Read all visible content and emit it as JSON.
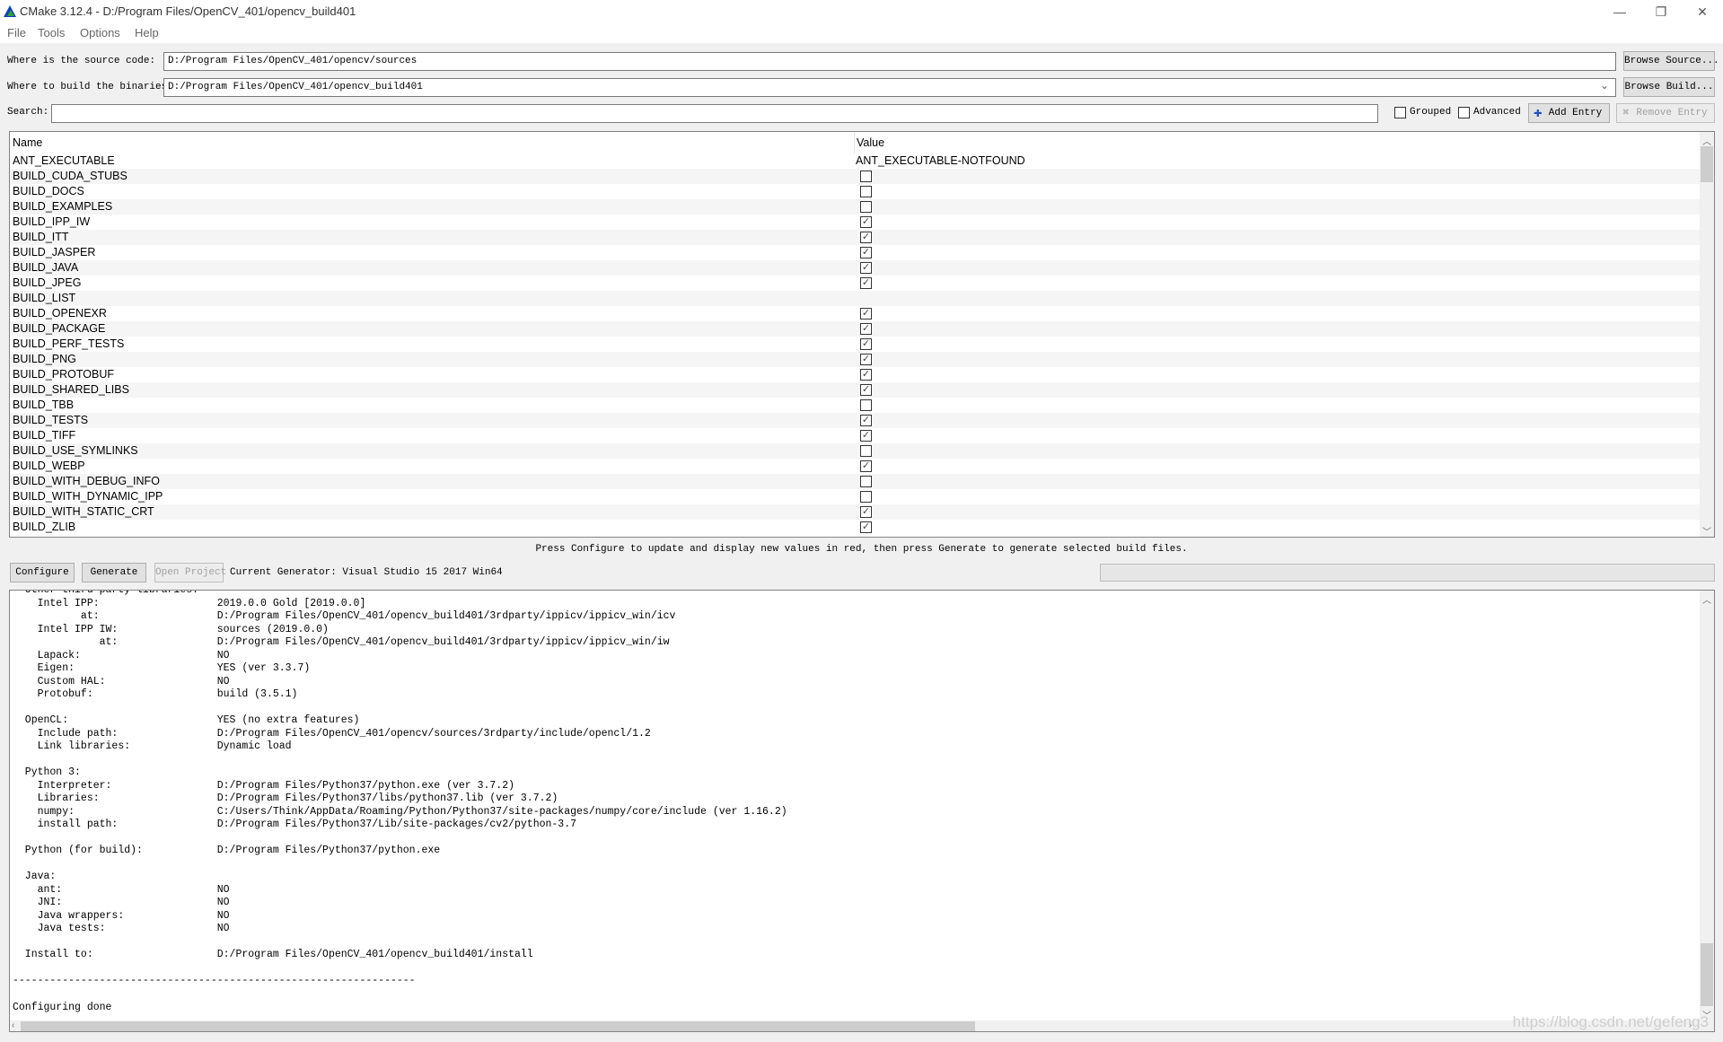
{
  "window": {
    "title": "CMake 3.12.4 - D:/Program Files/OpenCV_401/opencv_build401",
    "minimize": "—",
    "maximize": "❐",
    "close": "✕"
  },
  "menu": [
    "File",
    "Tools",
    "Options",
    "Help"
  ],
  "source": {
    "label": "Where is the source code:",
    "value": "D:/Program Files/OpenCV_401/opencv/sources",
    "button": "Browse Source..."
  },
  "build": {
    "label": "Where to build the binaries:",
    "value": "D:/Program Files/OpenCV_401/opencv_build401",
    "button": "Browse Build...",
    "dropdown_icon": "⌄"
  },
  "search": {
    "label": "Search:",
    "value": "",
    "grouped": {
      "label": "Grouped",
      "checked": false
    },
    "advanced": {
      "label": "Advanced",
      "checked": false
    },
    "add_entry": "Add Entry",
    "remove_entry": "Remove Entry"
  },
  "table": {
    "headers": {
      "name": "Name",
      "value": "Value"
    },
    "rows": [
      {
        "name": "ANT_EXECUTABLE",
        "type": "text",
        "value": "ANT_EXECUTABLE-NOTFOUND"
      },
      {
        "name": "BUILD_CUDA_STUBS",
        "type": "bool",
        "value": false
      },
      {
        "name": "BUILD_DOCS",
        "type": "bool",
        "value": false
      },
      {
        "name": "BUILD_EXAMPLES",
        "type": "bool",
        "value": false
      },
      {
        "name": "BUILD_IPP_IW",
        "type": "bool",
        "value": true
      },
      {
        "name": "BUILD_ITT",
        "type": "bool",
        "value": true
      },
      {
        "name": "BUILD_JASPER",
        "type": "bool",
        "value": true
      },
      {
        "name": "BUILD_JAVA",
        "type": "bool",
        "value": true
      },
      {
        "name": "BUILD_JPEG",
        "type": "bool",
        "value": true
      },
      {
        "name": "BUILD_LIST",
        "type": "text",
        "value": ""
      },
      {
        "name": "BUILD_OPENEXR",
        "type": "bool",
        "value": true
      },
      {
        "name": "BUILD_PACKAGE",
        "type": "bool",
        "value": true
      },
      {
        "name": "BUILD_PERF_TESTS",
        "type": "bool",
        "value": true
      },
      {
        "name": "BUILD_PNG",
        "type": "bool",
        "value": true
      },
      {
        "name": "BUILD_PROTOBUF",
        "type": "bool",
        "value": true
      },
      {
        "name": "BUILD_SHARED_LIBS",
        "type": "bool",
        "value": true
      },
      {
        "name": "BUILD_TBB",
        "type": "bool",
        "value": false
      },
      {
        "name": "BUILD_TESTS",
        "type": "bool",
        "value": true
      },
      {
        "name": "BUILD_TIFF",
        "type": "bool",
        "value": true
      },
      {
        "name": "BUILD_USE_SYMLINKS",
        "type": "bool",
        "value": false
      },
      {
        "name": "BUILD_WEBP",
        "type": "bool",
        "value": true
      },
      {
        "name": "BUILD_WITH_DEBUG_INFO",
        "type": "bool",
        "value": false
      },
      {
        "name": "BUILD_WITH_DYNAMIC_IPP",
        "type": "bool",
        "value": false
      },
      {
        "name": "BUILD_WITH_STATIC_CRT",
        "type": "bool",
        "value": true
      },
      {
        "name": "BUILD_ZLIB",
        "type": "bool",
        "value": true
      }
    ]
  },
  "hint": "Press Configure to update and display new values in red, then press Generate to generate selected build files.",
  "actions": {
    "configure": "Configure",
    "generate": "Generate",
    "open_project": "Open Project",
    "generator": "Current Generator: Visual Studio 15 2017 Win64",
    "progress": 0
  },
  "output": [
    "  Other third-party libraries:",
    "    Intel IPP:                   2019.0.0 Gold [2019.0.0]",
    "           at:                   D:/Program Files/OpenCV_401/opencv_build401/3rdparty/ippicv/ippicv_win/icv",
    "    Intel IPP IW:                sources (2019.0.0)",
    "              at:                D:/Program Files/OpenCV_401/opencv_build401/3rdparty/ippicv/ippicv_win/iw",
    "    Lapack:                      NO",
    "    Eigen:                       YES (ver 3.3.7)",
    "    Custom HAL:                  NO",
    "    Protobuf:                    build (3.5.1)",
    "",
    "  OpenCL:                        YES (no extra features)",
    "    Include path:                D:/Program Files/OpenCV_401/opencv/sources/3rdparty/include/opencl/1.2",
    "    Link libraries:              Dynamic load",
    "",
    "  Python 3:",
    "    Interpreter:                 D:/Program Files/Python37/python.exe (ver 3.7.2)",
    "    Libraries:                   D:/Program Files/Python37/libs/python37.lib (ver 3.7.2)",
    "    numpy:                       C:/Users/Think/AppData/Roaming/Python/Python37/site-packages/numpy/core/include (ver 1.16.2)",
    "    install path:                D:/Program Files/Python37/Lib/site-packages/cv2/python-3.7",
    "",
    "  Python (for build):            D:/Program Files/Python37/python.exe",
    "",
    "  Java:",
    "    ant:                         NO",
    "    JNI:                         NO",
    "    Java wrappers:               NO",
    "    Java tests:                  NO",
    "",
    "  Install to:                    D:/Program Files/OpenCV_401/opencv_build401/install",
    "",
    "-----------------------------------------------------------------",
    "",
    "Configuring done"
  ],
  "watermark": "https://blog.csdn.net/gefeng3"
}
